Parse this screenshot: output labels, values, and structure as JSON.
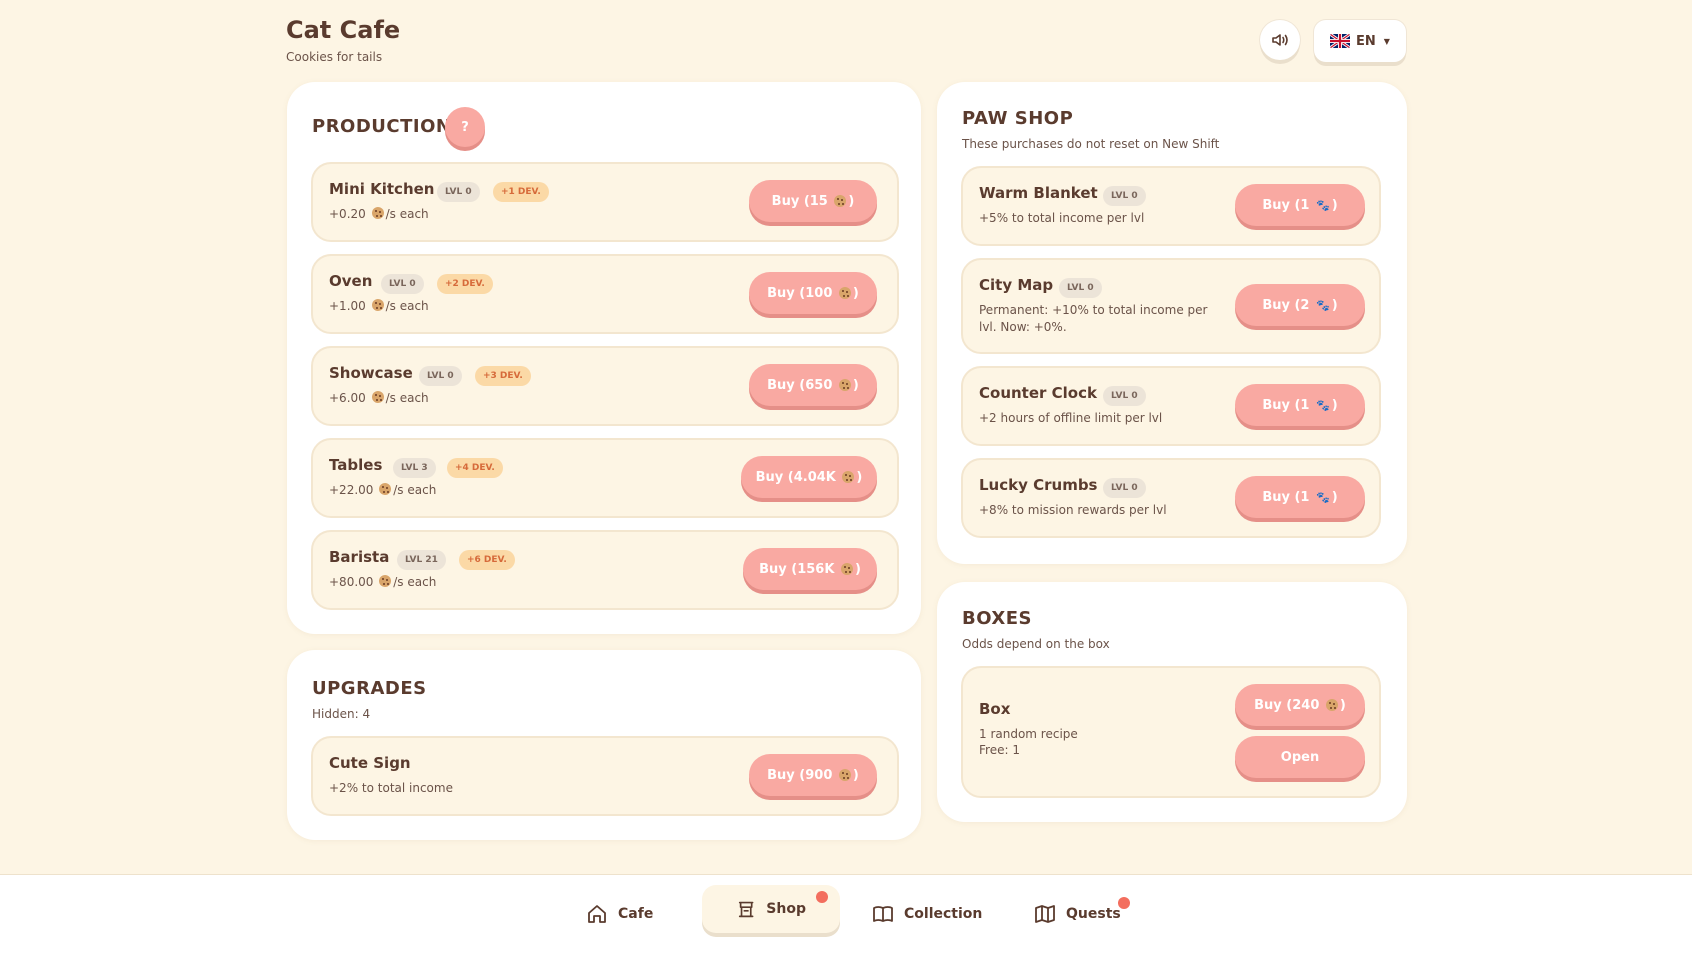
{
  "app": {
    "title": "Cat Cafe",
    "subtitle": "Cookies for tails"
  },
  "language": {
    "code": "EN"
  },
  "production": {
    "title": "PRODUCTION",
    "help_label": "?",
    "items": [
      {
        "name": "Mini Kitchen",
        "level": "LVL 0",
        "dev": "+1 DEV.",
        "rate_prefix": "+0.20",
        "rate_suffix": "/s each",
        "buy_prefix": "Buy (15",
        "buy_suffix": ")"
      },
      {
        "name": "Oven",
        "level": "LVL 0",
        "dev": "+2 DEV.",
        "rate_prefix": "+1.00",
        "rate_suffix": "/s each",
        "buy_prefix": "Buy (100",
        "buy_suffix": ")"
      },
      {
        "name": "Showcase",
        "level": "LVL 0",
        "dev": "+3 DEV.",
        "rate_prefix": "+6.00",
        "rate_suffix": "/s each",
        "buy_prefix": "Buy (650",
        "buy_suffix": ")"
      },
      {
        "name": "Tables",
        "level": "LVL 3",
        "dev": "+4 DEV.",
        "rate_prefix": "+22.00",
        "rate_suffix": "/s each",
        "buy_prefix": "Buy (4.04K",
        "buy_suffix": ")"
      },
      {
        "name": "Barista",
        "level": "LVL 21",
        "dev": "+6 DEV.",
        "rate_prefix": "+80.00",
        "rate_suffix": "/s each",
        "buy_prefix": "Buy (156K",
        "buy_suffix": ")"
      }
    ]
  },
  "upgrades": {
    "title": "UPGRADES",
    "hidden": "Hidden: 4",
    "items": [
      {
        "name": "Cute Sign",
        "desc": "+2% to total income",
        "buy_prefix": "Buy (900",
        "buy_suffix": ")"
      }
    ]
  },
  "paw_shop": {
    "title": "PAW SHOP",
    "subtitle": "These purchases do not reset on New Shift",
    "items": [
      {
        "name": "Warm Blanket",
        "level": "LVL 0",
        "desc": "+5% to total income per lvl",
        "buy_prefix": "Buy (1",
        "buy_suffix": ")"
      },
      {
        "name": "City Map",
        "level": "LVL 0",
        "desc": "Permanent: +10% to total income per lvl. Now: +0%.",
        "buy_prefix": "Buy (2",
        "buy_suffix": ")"
      },
      {
        "name": "Counter Clock",
        "level": "LVL 0",
        "desc": "+2 hours of offline limit per lvl",
        "buy_prefix": "Buy (1",
        "buy_suffix": ")"
      },
      {
        "name": "Lucky Crumbs",
        "level": "LVL 0",
        "desc": "+8% to mission rewards per lvl",
        "buy_prefix": "Buy (1",
        "buy_suffix": ")"
      }
    ]
  },
  "boxes": {
    "title": "BOXES",
    "subtitle": "Odds depend on the box",
    "box": {
      "name": "Box",
      "desc": "1 random recipe",
      "free": "Free: 1",
      "buy_prefix": "Buy (240",
      "buy_suffix": ")",
      "open_label": "Open"
    }
  },
  "nav": {
    "items": [
      {
        "label": "Cafe",
        "icon": "home-icon"
      },
      {
        "label": "Shop",
        "icon": "shop-icon",
        "active": true,
        "notification": true
      },
      {
        "label": "Collection",
        "icon": "book-icon"
      },
      {
        "label": "Quests",
        "icon": "map-icon",
        "notification": true
      }
    ]
  },
  "colors": {
    "background": "#fdf5e4",
    "accent": "#f9a9a2",
    "dev_badge": "#fbd9a6",
    "notification": "#f36e5e",
    "text": "#5a3b2e"
  }
}
